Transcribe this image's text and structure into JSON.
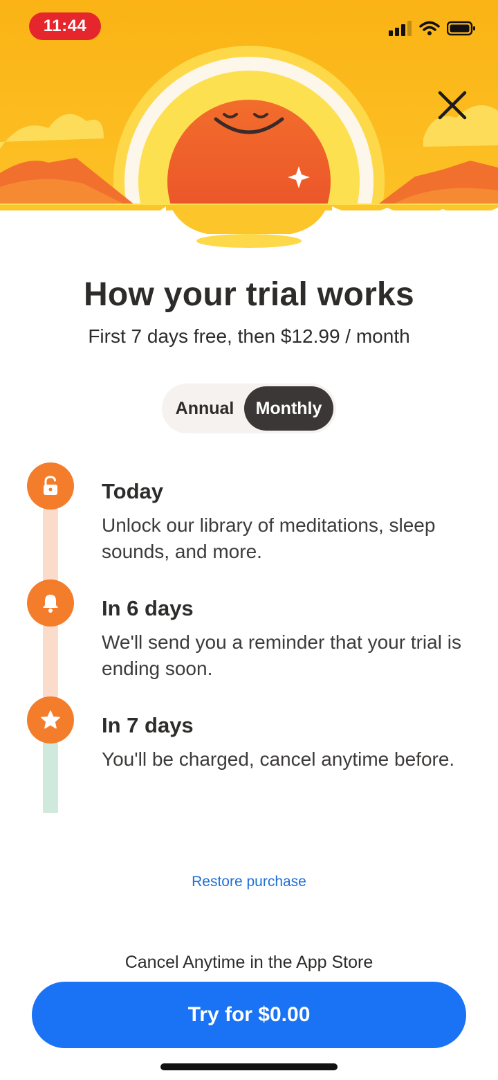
{
  "status_bar": {
    "time": "11:44"
  },
  "header": {
    "title": "How your trial works",
    "subtitle": "First 7 days free, then $12.99 / month"
  },
  "plan_toggle": {
    "options": [
      "Annual",
      "Monthly"
    ],
    "selected": "Monthly"
  },
  "timeline": [
    {
      "icon": "unlock-icon",
      "title": "Today",
      "description": "Unlock our library of meditations, sleep sounds, and more."
    },
    {
      "icon": "bell-icon",
      "title": "In 6 days",
      "description": "We'll send you a reminder that your trial is ending soon."
    },
    {
      "icon": "star-icon",
      "title": "In 7 days",
      "description": "You'll be charged, cancel anytime before."
    }
  ],
  "restore_label": "Restore purchase",
  "cancel_note": "Cancel Anytime in the App Store",
  "cta_label": "Try for $0.00",
  "colors": {
    "accent_orange": "#f47d2c",
    "cta_blue": "#1a73f5",
    "link_blue": "#1f6fd6",
    "hero_yellow": "#fbb817",
    "time_pill_red": "#e5262c"
  }
}
